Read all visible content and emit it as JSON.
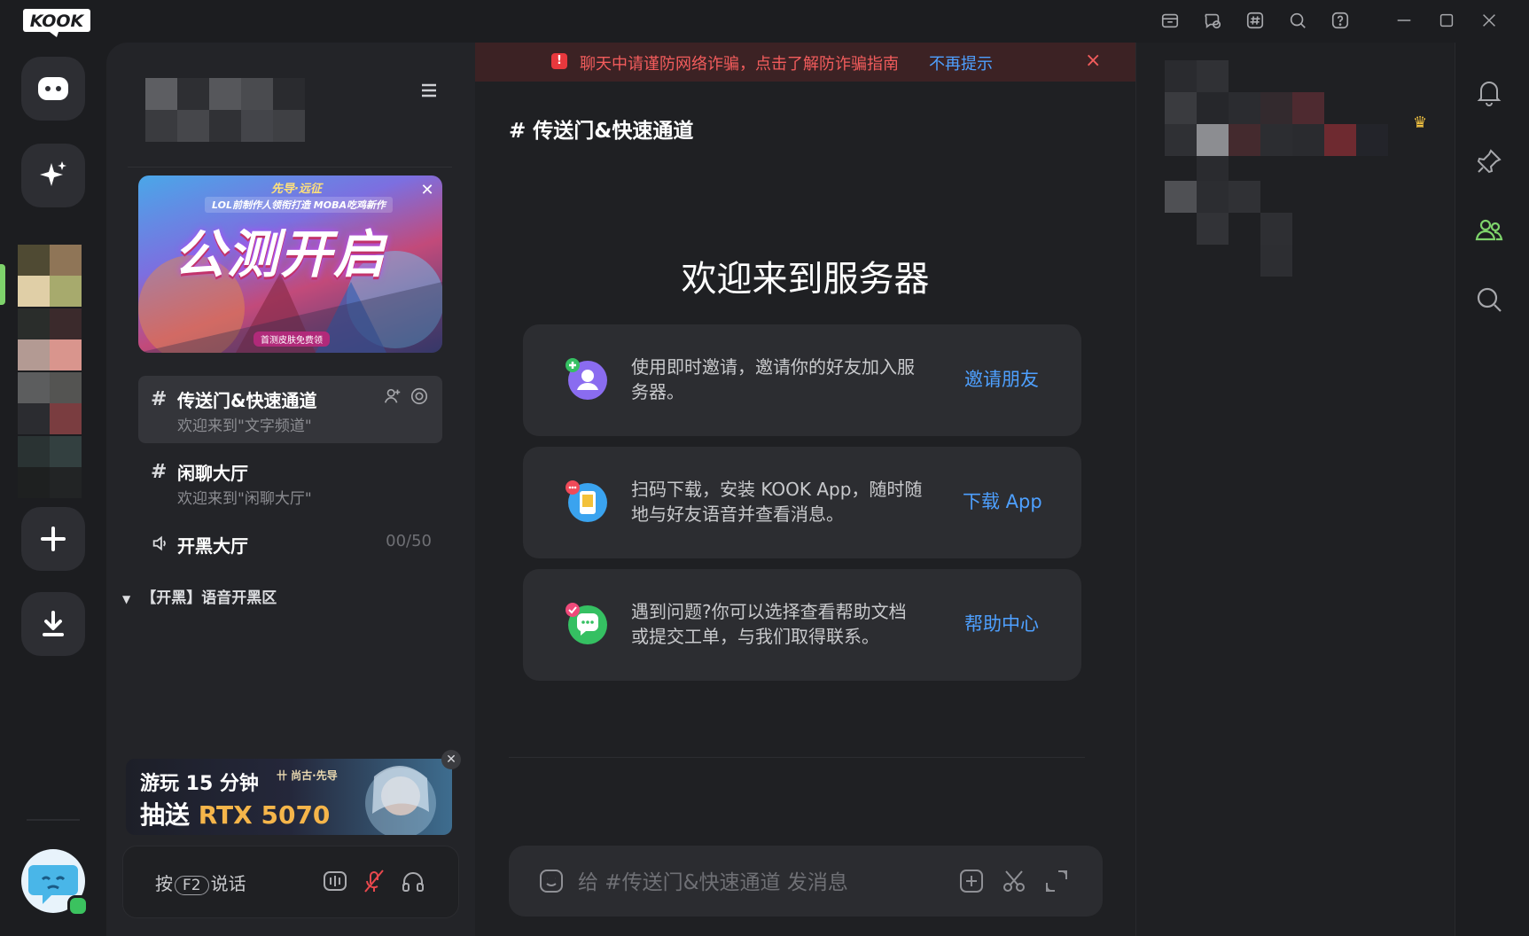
{
  "app": {
    "logo_text": "KOOK"
  },
  "titlebar": {
    "icons": [
      "store-icon",
      "chat-bubble-icon",
      "hash-box-icon",
      "search-icon",
      "help-icon",
      "minimize-icon",
      "maximize-icon",
      "close-icon"
    ]
  },
  "rail": {
    "items": [
      "direct-message",
      "discover",
      "server",
      "add-server",
      "download"
    ]
  },
  "sidebar": {
    "banner": {
      "top_text": "先导·远征",
      "subtitle": "LOL前制作人领衔打造 MOBA吃鸡新作",
      "title": "公测开启",
      "tag": "首测皮肤免费领"
    },
    "channels": [
      {
        "type": "text",
        "name": "传送门&快速通道",
        "desc": "欢迎来到\"文字频道\"",
        "active": true
      },
      {
        "type": "text",
        "name": "闲聊大厅",
        "desc": "欢迎来到\"闲聊大厅\"",
        "active": false
      },
      {
        "type": "voice",
        "name": "开黑大厅",
        "count": "00/50",
        "active": false
      }
    ],
    "category": "【开黑】语音开黑区",
    "promo": {
      "line1": "游玩 15 分钟",
      "line2_prefix": "抽送 ",
      "line2_highlight": "RTX 5070",
      "brand": "卄 尚古·先导"
    },
    "voicebar": {
      "ptt_prefix": "按",
      "ptt_key": "F2",
      "ptt_suffix": "说话"
    }
  },
  "alert": {
    "text": "聊天中请谨防网络诈骗，点击了解防诈骗指南",
    "link": "不再提示",
    "close": "×"
  },
  "main": {
    "channel_title": "# 传送门&快速通道",
    "welcome": "欢迎来到服务器",
    "cards": [
      {
        "text": "使用即时邀请，邀请你的好友加入服务器。",
        "link": "邀请朋友",
        "icon": "invite-user-icon"
      },
      {
        "text": "扫码下载，安装 KOOK App，随时随地与好友语音并查看消息。",
        "link": "下载 App",
        "icon": "mobile-app-icon"
      },
      {
        "text": "遇到问题?你可以选择查看帮助文档或提交工单，与我们取得联系。",
        "link": "帮助中心",
        "icon": "help-chat-icon"
      }
    ],
    "composer_placeholder": "给 #传送门&快速通道 发消息"
  },
  "right_icons": [
    "bell-icon",
    "pin-icon",
    "members-icon",
    "search-icon"
  ],
  "colors": {
    "accent": "#4ea0ff",
    "alert_red": "#f25c5c",
    "online": "#3bc25f",
    "members_active": "#7ed36b"
  }
}
